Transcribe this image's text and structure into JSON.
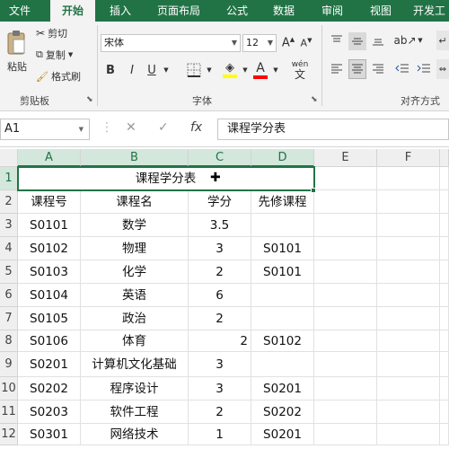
{
  "ribbon_tabs": [
    "文件",
    "开始",
    "插入",
    "页面布局",
    "公式",
    "数据",
    "审阅",
    "视图",
    "开发工"
  ],
  "active_tab": "开始",
  "clipboard": {
    "paste": "粘贴",
    "cut": "剪切",
    "copy": "复制",
    "format_painter": "格式刷",
    "group_label": "剪贴板"
  },
  "font": {
    "name": "宋体",
    "size": "12",
    "bold": "B",
    "italic": "I",
    "underline": "U",
    "font_color_glyph": "A",
    "wen_glyph": "wén",
    "group_label": "字体"
  },
  "alignment": {
    "group_label": "对齐方式"
  },
  "formula_bar": {
    "name_box": "A1",
    "fx": "fx",
    "formula": "课程学分表"
  },
  "columns": [
    "A",
    "B",
    "C",
    "D",
    "E",
    "F"
  ],
  "rows": [
    {
      "num": "1",
      "cells": [
        "课程学分表",
        "",
        "",
        ""
      ]
    },
    {
      "num": "2",
      "cells": [
        "课程号",
        "课程名",
        "学分",
        "先修课程"
      ]
    },
    {
      "num": "3",
      "cells": [
        "S0101",
        "数学",
        "3.5",
        ""
      ]
    },
    {
      "num": "4",
      "cells": [
        "S0102",
        "物理",
        "3",
        "S0101"
      ]
    },
    {
      "num": "5",
      "cells": [
        "S0103",
        "化学",
        "2",
        "S0101"
      ]
    },
    {
      "num": "6",
      "cells": [
        "S0104",
        "英语",
        "6",
        ""
      ]
    },
    {
      "num": "7",
      "cells": [
        "S0105",
        "政治",
        "2",
        ""
      ]
    },
    {
      "num": "8",
      "cells": [
        "S0106",
        "体育",
        "2",
        "S0102"
      ]
    },
    {
      "num": "9",
      "cells": [
        "S0201",
        "计算机文化基础",
        "3",
        ""
      ]
    },
    {
      "num": "10",
      "cells": [
        "S0202",
        "程序设计",
        "3",
        "S0201"
      ]
    },
    {
      "num": "11",
      "cells": [
        "S0203",
        "软件工程",
        "2",
        "S0202"
      ]
    },
    {
      "num": "12",
      "cells": [
        "S0301",
        "网络技术",
        "1",
        "S0201"
      ]
    }
  ],
  "colors": {
    "accent": "#217346",
    "ribbon_bg": "#f3f3f3",
    "header_bg": "#efefef"
  }
}
